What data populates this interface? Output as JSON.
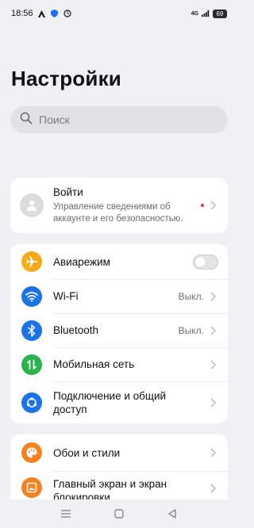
{
  "status_bar": {
    "time": "18:56",
    "network": "4G",
    "battery": "69"
  },
  "page": {
    "title": "Настройки"
  },
  "search": {
    "placeholder": "Поиск"
  },
  "account": {
    "title": "Войти",
    "subtitle": "Управление сведениями об аккаунте и его безопасностью."
  },
  "network_group": {
    "items": [
      {
        "label": "Авиарежим",
        "icon": "airplane-icon",
        "color": "#f7a916",
        "control": "toggle",
        "toggle_on": false
      },
      {
        "label": "Wi-Fi",
        "value": "Выкл.",
        "icon": "wifi-icon",
        "color": "#1a73e8"
      },
      {
        "label": "Bluetooth",
        "value": "Выкл.",
        "icon": "bluetooth-icon",
        "color": "#1a73e8"
      },
      {
        "label": "Мобильная сеть",
        "icon": "mobile-data-icon",
        "color": "#2bb24c"
      },
      {
        "label": "Подключение и общий доступ",
        "icon": "share-connection-icon",
        "color": "#1a73e8"
      }
    ]
  },
  "display_group": {
    "items": [
      {
        "label": "Обои и стили",
        "icon": "palette-icon",
        "color": "#f58220"
      },
      {
        "label": "Главный экран и экран блокировки",
        "icon": "home-screen-icon",
        "color": "#f58220"
      }
    ]
  },
  "nav_bar": {
    "buttons": [
      "menu-icon",
      "home-icon",
      "back-icon"
    ]
  }
}
